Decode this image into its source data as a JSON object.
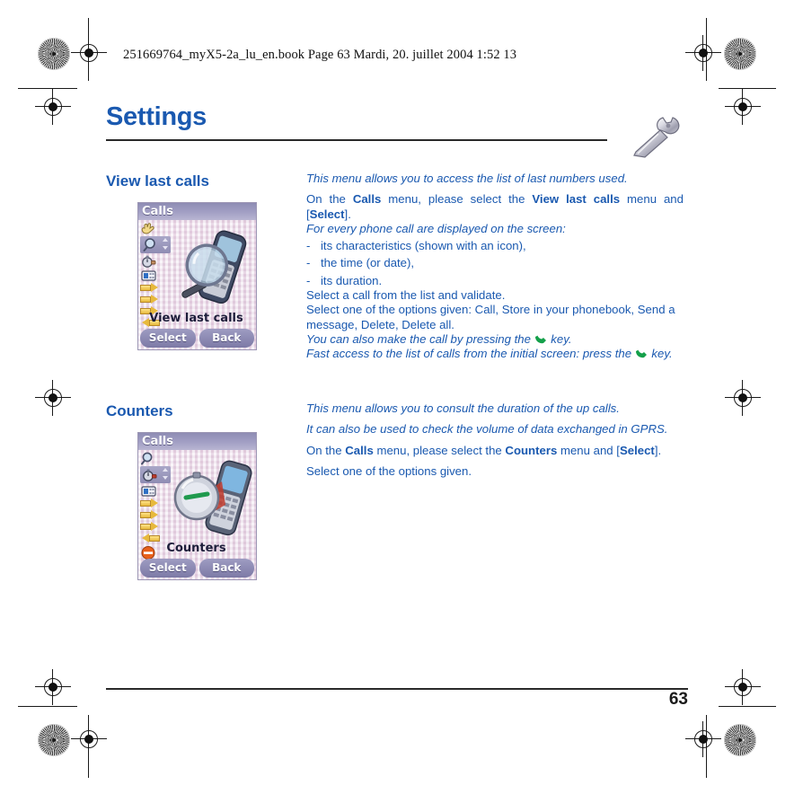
{
  "running_head": "251669764_myX5-2a_lu_en.book  Page 63  Mardi, 20. juillet 2004  1:52 13",
  "page": {
    "title": "Settings",
    "number": "63",
    "title_color": "#1a59b0",
    "body_color": "#1a59b0",
    "header_icon": "wrench-icon"
  },
  "sections": [
    {
      "heading": "View last calls",
      "intro_italic": "This menu allows you to access the list of last numbers used.",
      "instruction": {
        "pre": "On the ",
        "menu1": "Calls",
        "mid1": " menu, please select the ",
        "menu2": "View last calls",
        "mid2": " menu and [",
        "softkey": "Select",
        "post": "]."
      },
      "sub_italic": "For every phone call are displayed on the screen:",
      "bullets": [
        "its characteristics (shown with an icon),",
        "the time (or date),",
        "its duration."
      ],
      "lines": [
        "Select a call from the list and validate.",
        "Select one of the options given: Call, Store in your phonebook, Send a message, Delete, Delete all."
      ],
      "notes": [
        {
          "pre": "You can also make the call by pressing the ",
          "icon": "phone-call-key-icon",
          "post": " key."
        },
        {
          "pre": "Fast access to the list of calls from the initial screen: press the ",
          "icon": "phone-call-key-icon",
          "post": " key."
        }
      ],
      "screenshot": {
        "title": "Calls",
        "label": "View last calls",
        "softkeys": [
          "Select",
          "Back"
        ],
        "sidebar_icons": [
          "hand-stop-icon",
          "magnifier-icon",
          "stopwatch-icon",
          "keypad-icon",
          "arrow-right-icon",
          "arrow-right-icon",
          "arrow-right-icon",
          "arrow-left-icon"
        ],
        "selected_icon_index": 1,
        "artwork": "magnifier-over-phone"
      }
    },
    {
      "heading": "Counters",
      "intro_italic": "This menu allows you to consult the duration of the up calls.",
      "intro_italic2": "It can also be used to check the volume of data exchanged in GPRS.",
      "instruction": {
        "pre": "On the ",
        "menu1": "Calls",
        "mid1": " menu, please select the ",
        "menu2": "Counters",
        "mid2": " menu and [",
        "softkey": "Select",
        "post": "]."
      },
      "lines": [
        "Select one of the options given."
      ],
      "screenshot": {
        "title": "Calls",
        "label": "Counters",
        "softkeys": [
          "Select",
          "Back"
        ],
        "sidebar_icons": [
          "magnifier-icon",
          "stopwatch-icon",
          "keypad-icon",
          "arrow-right-icon",
          "arrow-right-icon",
          "arrow-right-icon",
          "arrow-left-icon",
          "no-entry-icon"
        ],
        "selected_icon_index": 1,
        "artwork": "stopwatch-and-phone"
      }
    }
  ]
}
